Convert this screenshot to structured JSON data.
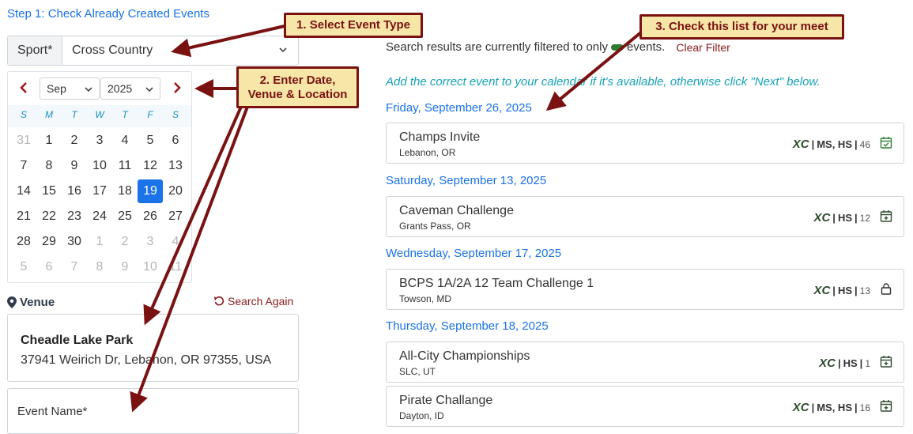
{
  "step_title": "Step 1: Check Already Created Events",
  "sport": {
    "label": "Sport*",
    "value": "Cross Country"
  },
  "calendar": {
    "month": "Sep",
    "year": "2025",
    "weekdays": [
      "S",
      "M",
      "T",
      "W",
      "T",
      "F",
      "S"
    ],
    "weeks": [
      [
        "31",
        "1",
        "2",
        "3",
        "4",
        "5",
        "6"
      ],
      [
        "7",
        "8",
        "9",
        "10",
        "11",
        "12",
        "13"
      ],
      [
        "14",
        "15",
        "16",
        "17",
        "18",
        "19",
        "20"
      ],
      [
        "21",
        "22",
        "23",
        "24",
        "25",
        "26",
        "27"
      ],
      [
        "28",
        "29",
        "30",
        "1",
        "2",
        "3",
        "4"
      ],
      [
        "5",
        "6",
        "7",
        "8",
        "9",
        "10",
        "11"
      ]
    ],
    "selected_day": "19"
  },
  "venue": {
    "title": "Venue",
    "search_again": "Search Again",
    "name": "Cheadle Lake Park",
    "address": "37941 Weirich Dr, Lebanon, OR 97355, USA"
  },
  "event_name_placeholder": "Event Name*",
  "filter": {
    "prefix": "Search results are currently filtered to only",
    "suffix": "events.",
    "clear": "Clear Filter",
    "pill_color": "#2e7d32"
  },
  "hint": "Add the correct event to your calendar if it's available, otherwise click \"Next\" below.",
  "groups": [
    {
      "date": "Friday, September 26, 2025",
      "events": [
        {
          "name": "Champs Invite",
          "location": "Lebanon, OR",
          "sport": "XC",
          "levels": "MS, HS",
          "count": "46",
          "icon": "calendar-check-icon"
        }
      ]
    },
    {
      "date": "Saturday, September 13, 2025",
      "events": [
        {
          "name": "Caveman Challenge",
          "location": "Grants Pass, OR",
          "sport": "XC",
          "levels": "HS",
          "count": "12",
          "icon": "calendar-plus-icon"
        }
      ]
    },
    {
      "date": "Wednesday, September 17, 2025",
      "events": [
        {
          "name": "BCPS 1A/2A 12 Team Challenge 1",
          "location": "Towson, MD",
          "sport": "XC",
          "levels": "HS",
          "count": "13",
          "icon": "lock-icon"
        }
      ]
    },
    {
      "date": "Thursday, September 18, 2025",
      "events": [
        {
          "name": "All-City Championships",
          "location": "SLC, UT",
          "sport": "XC",
          "levels": "HS",
          "count": "1",
          "icon": "calendar-plus-icon"
        },
        {
          "name": "Pirate Challange",
          "location": "Dayton, ID",
          "sport": "XC",
          "levels": "MS, HS",
          "count": "16",
          "icon": "calendar-plus-icon"
        }
      ]
    }
  ],
  "annotations": {
    "one": "1. Select Event Type",
    "two_line1": "2. Enter Date,",
    "two_line2": "Venue & Location",
    "three": "3. Check this list for your meet"
  }
}
